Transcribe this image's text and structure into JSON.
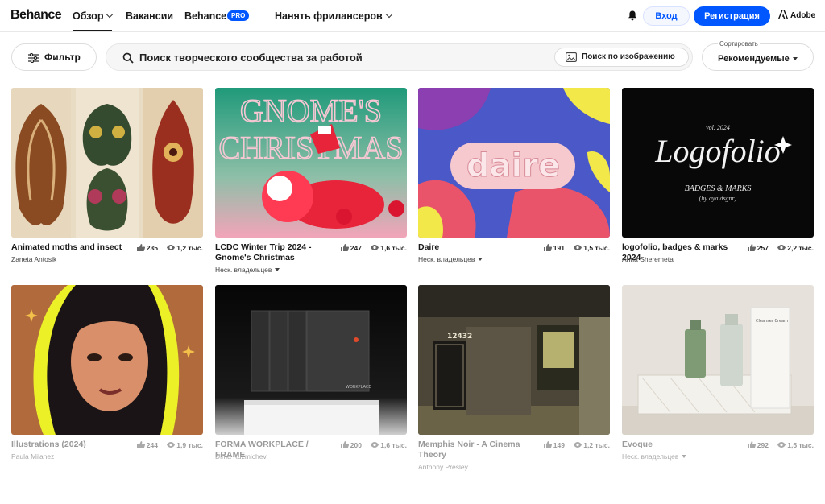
{
  "nav": {
    "logo": "Behance",
    "explore": "Обзор",
    "jobs": "Вакансии",
    "behance_pro": "Behance",
    "pro_badge": "PRO",
    "hire": "Нанять фрилансеров",
    "login": "Вход",
    "signup": "Регистрация",
    "adobe": "Adobe"
  },
  "filters": {
    "filter_label": "Фильтр",
    "search_placeholder": "Поиск творческого сообщества за работой",
    "image_search": "Поиск по изображению",
    "sort_label": "Сортировать",
    "sort_value": "Рекомендуемые"
  },
  "projects": [
    {
      "title": "Animated moths and insect",
      "owner": "Zaneta Antosik",
      "likes": "235",
      "views": "1,2 тыс."
    },
    {
      "title": "LCDC Winter Trip 2024 - Gnome's Christmas",
      "owner": "Неск. владельцев",
      "likes": "247",
      "views": "1,6 тыс."
    },
    {
      "title": "Daire",
      "owner": "Неск. владельцев",
      "likes": "191",
      "views": "1,5 тыс."
    },
    {
      "title": "logofolio, badges & marks 2024",
      "owner": "Anna Sheremeta",
      "likes": "257",
      "views": "2,2 тыс."
    },
    {
      "title": "Illustrations (2024)",
      "owner": "Paula Milanez",
      "likes": "244",
      "views": "1,9 тыс."
    },
    {
      "title": "FORMA WORKPLACE / FRAME",
      "owner": "Dima Kuzmichev",
      "likes": "200",
      "views": "1,6 тыс."
    },
    {
      "title": "Memphis Noir - A Cinema Theory",
      "owner": "Anthony Presley",
      "likes": "149",
      "views": "1,2 тыс."
    },
    {
      "title": "Evoque",
      "owner": "Неск. владельцев",
      "likes": "292",
      "views": "1,5 тыс."
    }
  ],
  "artwork_text": {
    "gnome_line1": "GNOME'S",
    "gnome_line2": "CHRISTMAS",
    "daire": "daire",
    "logofolio_vol": "vol. 2024",
    "logofolio_title": "Logofolio",
    "logofolio_sub": "BADGES & MARKS",
    "logofolio_by": "(by aya.dsgnr)",
    "forma_label": "WORKPLACE",
    "memphis_number": "12432",
    "evoque_box": "Cleanser Cream"
  },
  "colors": {
    "brand_blue": "#0057ff",
    "text_dark": "#191919"
  }
}
